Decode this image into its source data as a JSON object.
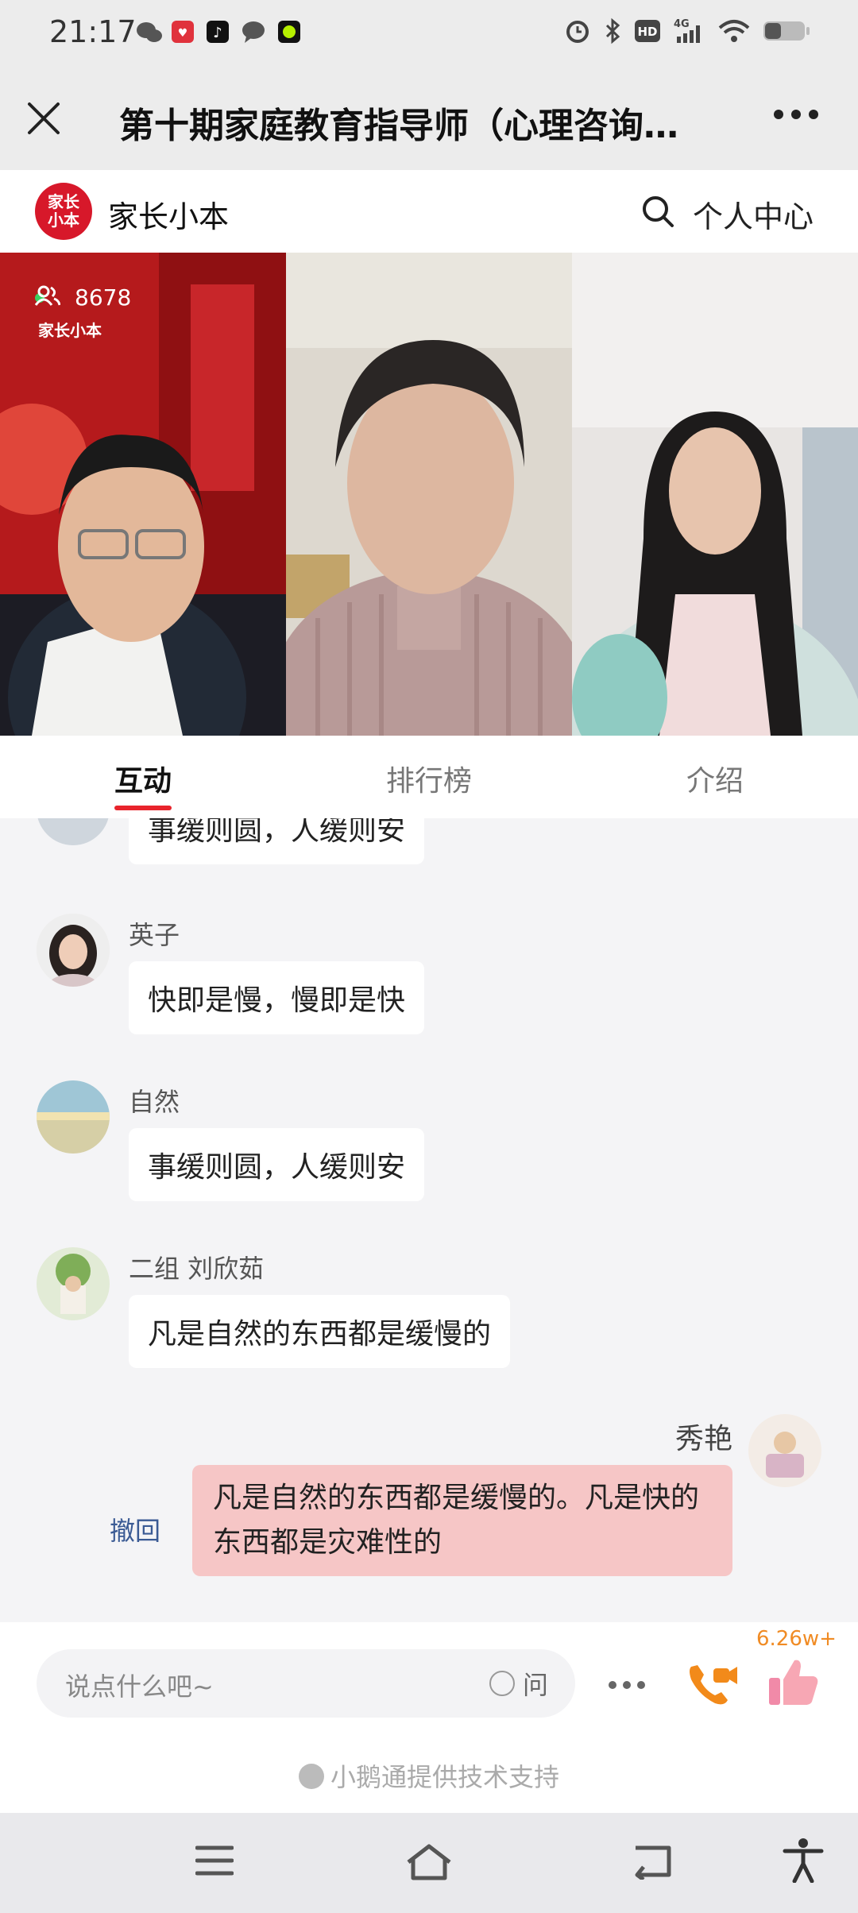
{
  "status_bar": {
    "time": "21:17",
    "icons_left": [
      "wechat-icon",
      "app-icon",
      "tiktok-icon",
      "message-icon",
      "app2-icon"
    ],
    "icons_right": [
      "alarm-icon",
      "bluetooth-icon",
      "hd-icon",
      "signal-4g-icon",
      "wifi-icon",
      "battery-icon"
    ],
    "hd": "HD",
    "network": "4G"
  },
  "header": {
    "title": "第十期家庭教育指导师（心理咨询…"
  },
  "brand": {
    "logo_text": "家长小本",
    "name": "家长小本",
    "user_center": "个人中心"
  },
  "video": {
    "viewers": "8678",
    "watermark": "家长小本"
  },
  "tabs": [
    {
      "label": "互动",
      "active": true
    },
    {
      "label": "排行榜",
      "active": false
    },
    {
      "label": "介绍",
      "active": false
    }
  ],
  "messages": [
    {
      "name": "",
      "text": "事缓则圆，人缓则安"
    },
    {
      "name": "英子",
      "text": "快即是慢，慢即是快"
    },
    {
      "name": "自然",
      "text": "事缓则圆，人缓则安"
    },
    {
      "name": "二组 刘欣茹",
      "text": "凡是自然的东西都是缓慢的"
    }
  ],
  "my_message": {
    "name": "秀艳",
    "text": "凡是自然的东西都是缓慢的。凡是快的东西都是灾难性的",
    "withdraw": "撤回"
  },
  "input": {
    "placeholder": "说点什么吧~",
    "ask_label": "问",
    "like_count": "6.26w+"
  },
  "footer": {
    "support": "小鹅通提供技术支持"
  },
  "colors": {
    "accent": "#e8242c",
    "brand_red": "#d7182a",
    "my_bubble": "#f6c6c6",
    "like_orange": "#f08b24"
  }
}
